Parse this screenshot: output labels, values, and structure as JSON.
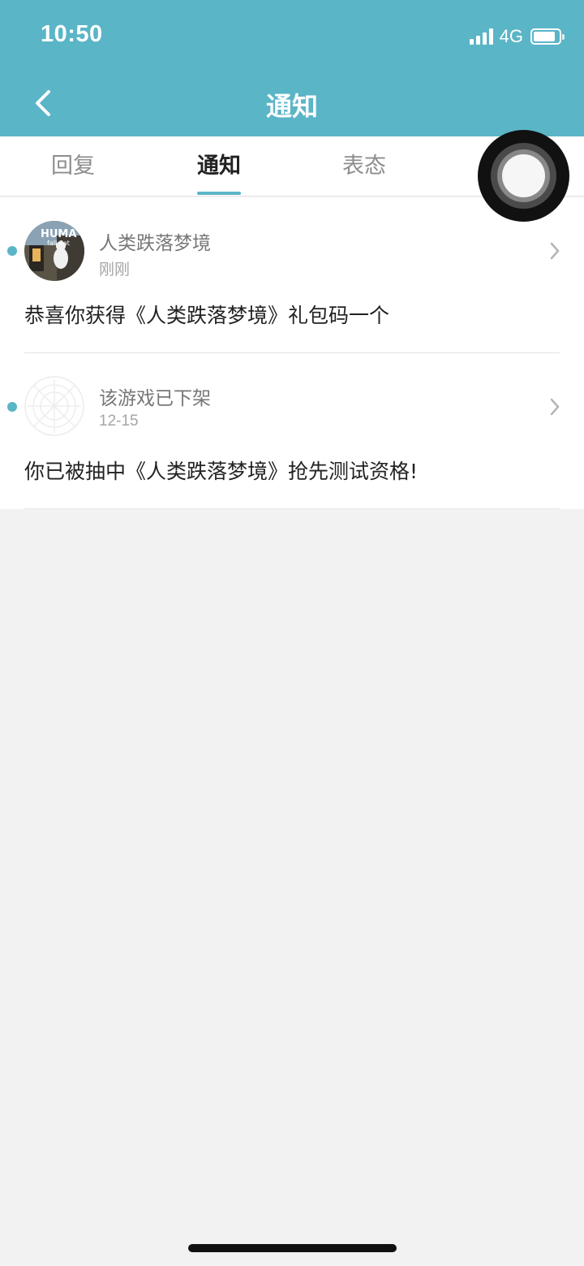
{
  "status_bar": {
    "time": "10:50",
    "network": "4G",
    "battery_level": 0.85,
    "icons": [
      "signal-icon",
      "battery-icon"
    ]
  },
  "nav": {
    "title": "通知",
    "back_icon": "chevron-left-icon"
  },
  "tabs": [
    {
      "label": "回复",
      "active": false
    },
    {
      "label": "通知",
      "active": true
    },
    {
      "label": "表态",
      "active": false
    }
  ],
  "notifications": [
    {
      "title": "人类跌落梦境",
      "time": "刚刚",
      "message": "恭喜你获得《人类跌落梦境》礼包码一个",
      "unread": true
    },
    {
      "title": "该游戏已下架",
      "time": "12-15",
      "message": "你已被抽中《人类跌落梦境》抢先测试资格!",
      "unread": true
    }
  ],
  "colors": {
    "accent": "#5ab5c7",
    "background": "#f2f2f2",
    "text_primary": "#222222",
    "text_secondary": "#777777"
  }
}
